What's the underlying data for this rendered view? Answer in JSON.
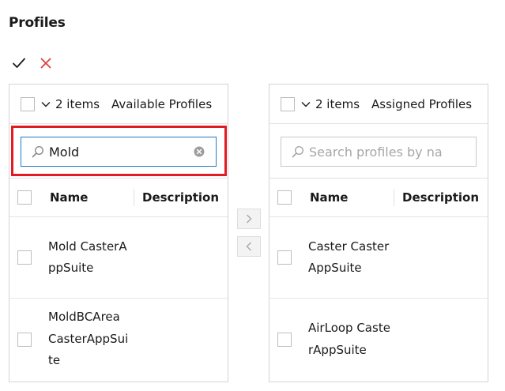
{
  "page": {
    "title": "Profiles"
  },
  "actions": {
    "confirm_icon": "check-icon",
    "cancel_icon": "close-icon",
    "cancel_color": "#e0403b",
    "highlight_color": "#e11b22",
    "focus_color": "#1f7ac9"
  },
  "available": {
    "count": "2 items",
    "title": "Available Profiles",
    "search_value": "Mold",
    "columns": {
      "name": "Name",
      "description": "Description"
    },
    "rows": [
      {
        "name": "Mold CasterAppSuite",
        "description": ""
      },
      {
        "name": "MoldBCArea CasterAppSuite",
        "description": ""
      }
    ]
  },
  "assigned": {
    "count": "2 items",
    "title": "Assigned Profiles",
    "search_placeholder": "Search profiles by na...",
    "columns": {
      "name": "Name",
      "description": "Description"
    },
    "rows": [
      {
        "name": "Caster CasterAppSuite",
        "description": ""
      },
      {
        "name": "AirLoop CasterAppSuite",
        "description": ""
      }
    ]
  },
  "transfer": {
    "move_right": ">",
    "move_left": "<"
  }
}
